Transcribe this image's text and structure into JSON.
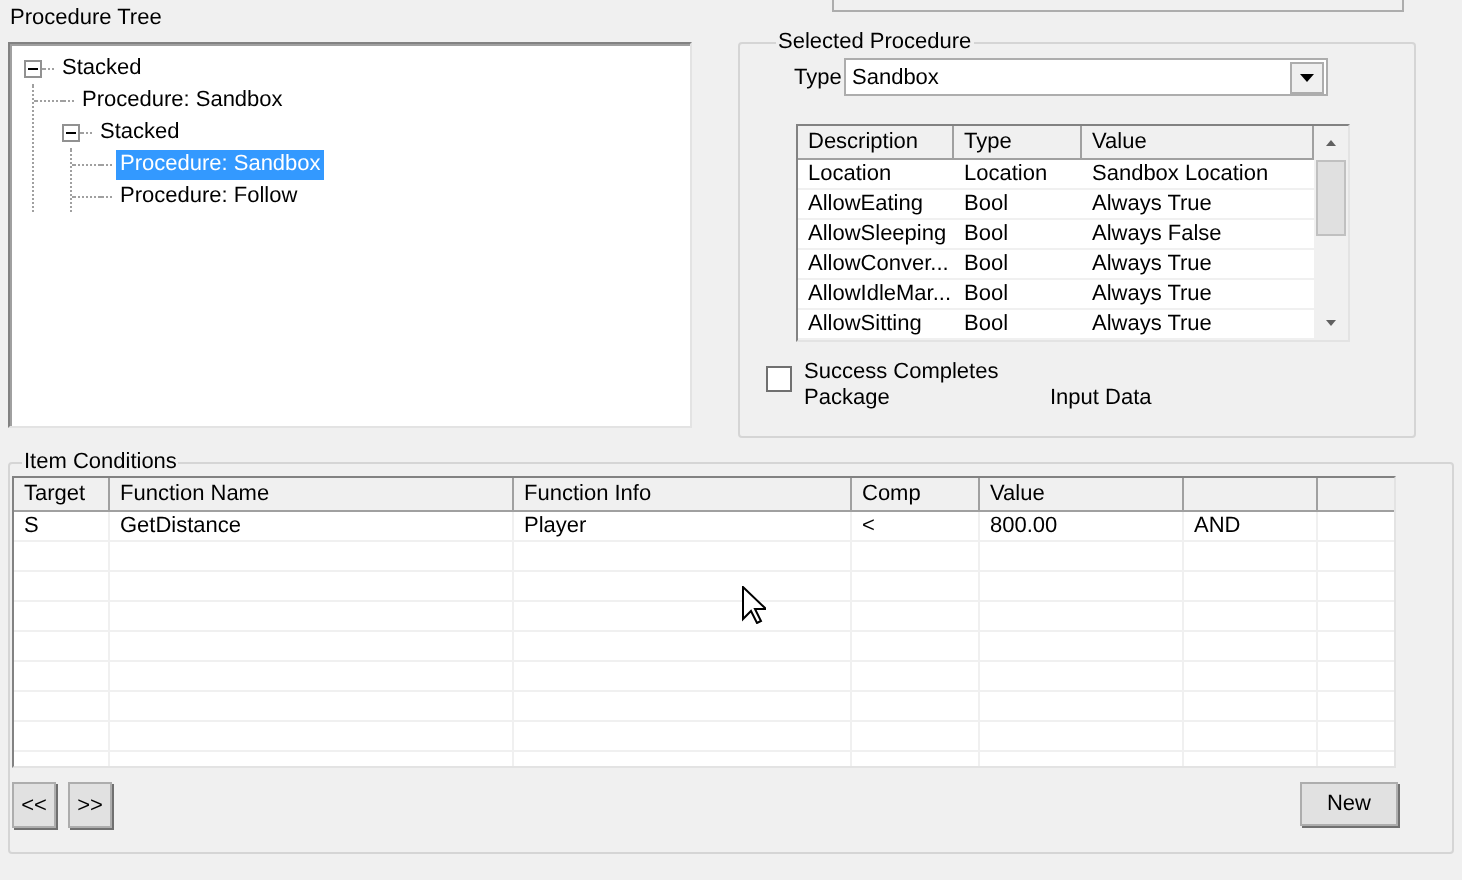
{
  "procedure_tree": {
    "title": "Procedure Tree",
    "nodes": [
      {
        "label": "Stacked",
        "expanded": true,
        "selected": false,
        "children": [
          {
            "label": "Procedure: Sandbox",
            "selected": false
          },
          {
            "label": "Stacked",
            "expanded": true,
            "selected": false,
            "children": [
              {
                "label": "Procedure: Sandbox",
                "selected": true
              },
              {
                "label": "Procedure: Follow",
                "selected": false
              }
            ]
          }
        ]
      }
    ]
  },
  "selected_procedure": {
    "title": "Selected Procedure",
    "type_label": "Type",
    "type_value": "Sandbox",
    "parameters": {
      "columns": [
        "Description",
        "Type",
        "Value"
      ],
      "rows": [
        [
          "Location",
          "Location",
          "Sandbox Location"
        ],
        [
          "AllowEating",
          "Bool",
          "Always True"
        ],
        [
          "AllowSleeping",
          "Bool",
          "Always False"
        ],
        [
          "AllowConver...",
          "Bool",
          "Always True"
        ],
        [
          "AllowIdleMar...",
          "Bool",
          "Always True"
        ],
        [
          "AllowSitting",
          "Bool",
          "Always True"
        ]
      ]
    },
    "success_completes": {
      "label": "Success Completes Package",
      "checked": false
    },
    "input_data_label": "Input Data"
  },
  "item_conditions": {
    "title": "Item Conditions",
    "columns": [
      "Target",
      "Function Name",
      "Function Info",
      "Comp",
      "Value"
    ],
    "rows": [
      [
        "S",
        "GetDistance",
        "Player",
        "<",
        "800.00",
        "AND"
      ]
    ],
    "buttons": {
      "previous": "<<",
      "next": ">>",
      "new": "New"
    }
  }
}
